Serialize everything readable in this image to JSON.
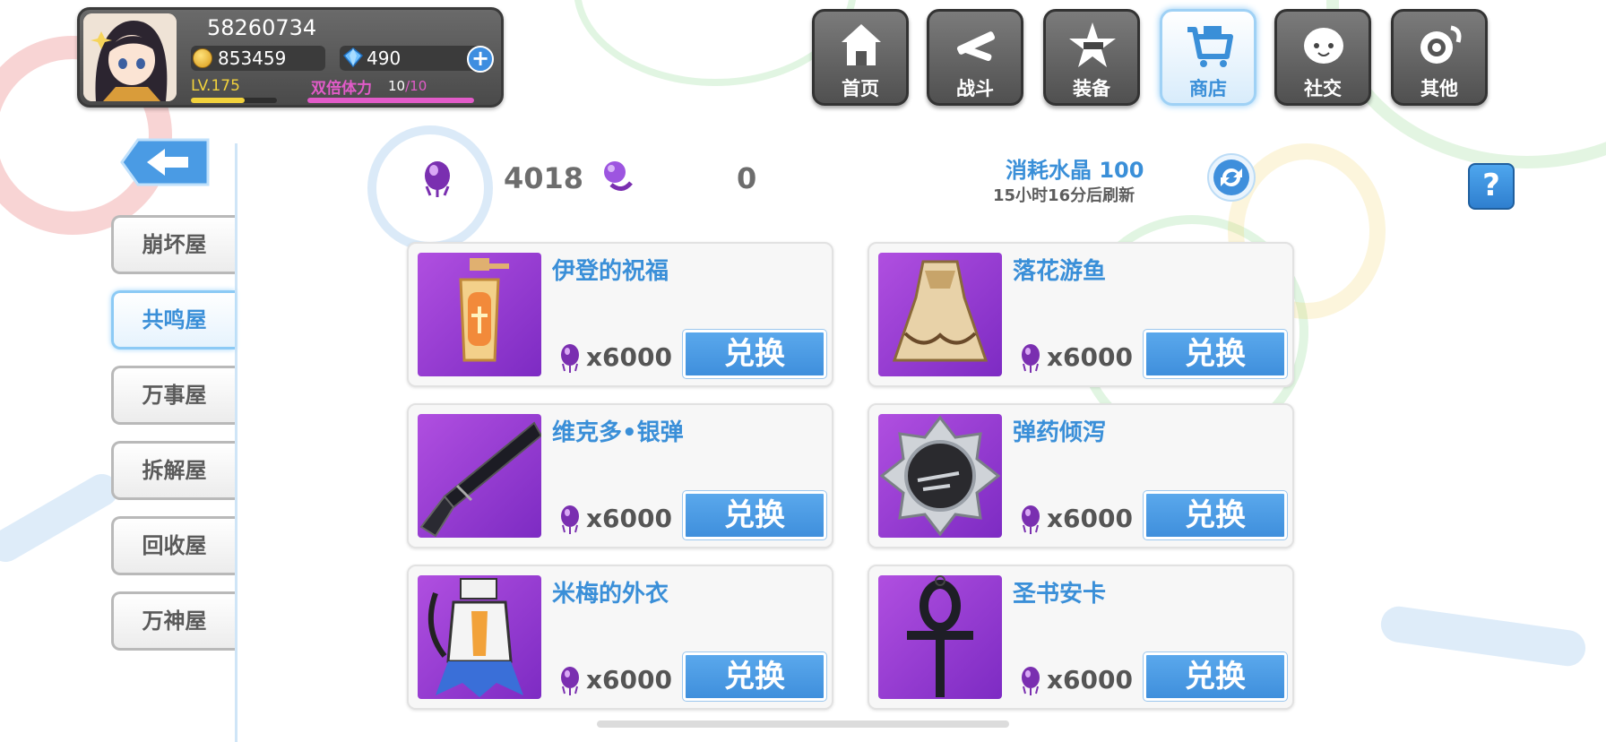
{
  "player": {
    "id": "58260734",
    "gold": "853459",
    "gems": "490",
    "level": "LV.175",
    "exp_progress": 0.62,
    "stamina_label": "双倍体力",
    "stamina_current": "10",
    "stamina_max": "/10",
    "stamina_progress": 1.0
  },
  "nav": [
    {
      "label": "首页",
      "icon": "house-icon"
    },
    {
      "label": "战斗",
      "icon": "battle-icon"
    },
    {
      "label": "装备",
      "icon": "equipment-icon"
    },
    {
      "label": "商店",
      "icon": "shop-basket-icon",
      "active": true
    },
    {
      "label": "社交",
      "icon": "social-icon"
    },
    {
      "label": "其他",
      "icon": "settings-icon"
    }
  ],
  "sidebar": {
    "tabs": [
      {
        "label": "崩坏屋"
      },
      {
        "label": "共鸣屋",
        "active": true
      },
      {
        "label": "万事屋"
      },
      {
        "label": "拆解屋"
      },
      {
        "label": "回收屋"
      },
      {
        "label": "万神屋"
      }
    ]
  },
  "shop": {
    "crystal_count": "4018",
    "secondary_count": "0",
    "refresh_cost_label": "消耗水晶 100",
    "refresh_time": "15小时16分后刷新",
    "help_label": "?",
    "redeem_label": "兑换",
    "items": [
      {
        "name": "伊登的祝福",
        "price": "x6000",
        "icon": "lantern-icon"
      },
      {
        "name": "落花游鱼",
        "price": "x6000",
        "icon": "dress-icon"
      },
      {
        "name": "维克多•银弹",
        "price": "x6000",
        "icon": "gun-icon"
      },
      {
        "name": "弹药倾泻",
        "price": "x6000",
        "icon": "badge-icon"
      },
      {
        "name": "米梅的外衣",
        "price": "x6000",
        "icon": "costume-icon"
      },
      {
        "name": "圣书安卡",
        "price": "x6000",
        "icon": "ankh-icon"
      }
    ]
  },
  "colors": {
    "accent": "#3a8fd8",
    "button": "#4a9be4",
    "item_bg": "#9b3fd8",
    "stamina": "#e25bc9",
    "level": "#f2d23c"
  }
}
